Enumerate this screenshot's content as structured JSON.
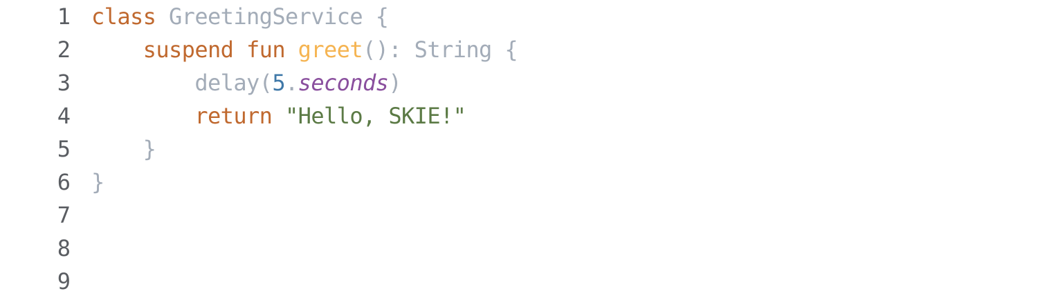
{
  "editor": {
    "line_numbers": [
      "1",
      "2",
      "3",
      "4",
      "5",
      "6",
      "7",
      "8",
      "9"
    ],
    "lines": [
      {
        "t": [
          {
            "kind": "kw",
            "text": "class"
          },
          {
            "kind": "id",
            "text": " GreetingService {"
          }
        ]
      },
      {
        "t": [
          {
            "kind": "id",
            "text": "    "
          },
          {
            "kind": "kw",
            "text": "suspend fun"
          },
          {
            "kind": "id",
            "text": " "
          },
          {
            "kind": "fn",
            "text": "greet"
          },
          {
            "kind": "id",
            "text": "(): String {"
          }
        ]
      },
      {
        "t": [
          {
            "kind": "id",
            "text": "        delay("
          },
          {
            "kind": "num",
            "text": "5"
          },
          {
            "kind": "id",
            "text": "."
          },
          {
            "kind": "prop",
            "text": "seconds"
          },
          {
            "kind": "id",
            "text": ")"
          }
        ]
      },
      {
        "t": [
          {
            "kind": "id",
            "text": "        "
          },
          {
            "kind": "kw",
            "text": "return"
          },
          {
            "kind": "id",
            "text": " "
          },
          {
            "kind": "str",
            "text": "\"Hello, SKIE!\""
          }
        ]
      },
      {
        "t": [
          {
            "kind": "id",
            "text": "    }"
          }
        ]
      },
      {
        "t": [
          {
            "kind": "id",
            "text": "}"
          }
        ]
      },
      {
        "t": []
      },
      {
        "t": []
      },
      {
        "t": []
      }
    ],
    "colors": {
      "keyword": "#c0692f",
      "function": "#f5b452",
      "identifier": "#a3acb8",
      "number": "#3f78a8",
      "property": "#8a4f9e",
      "string": "#5b7a45",
      "gutter": "#5a5d62"
    }
  }
}
